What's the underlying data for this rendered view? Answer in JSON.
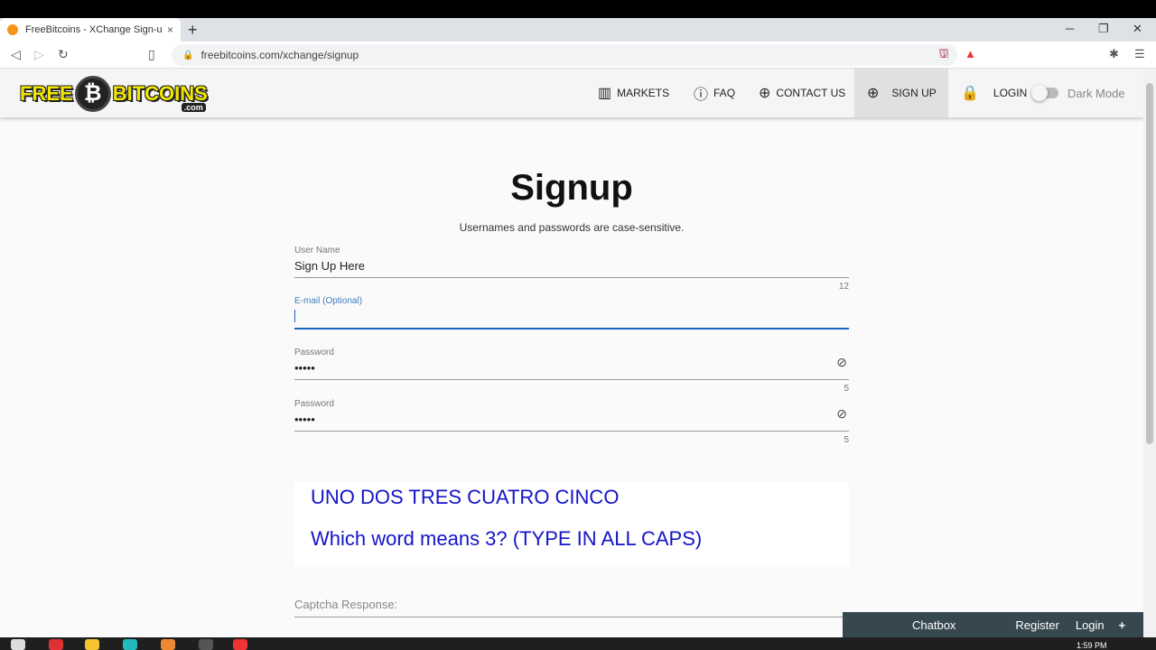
{
  "browser": {
    "tab_title": "FreeBitcoins - XChange Sign-up |",
    "tab_close": "×",
    "new_tab": "+",
    "url": "freebitcoins.com/xchange/signup",
    "win_minimize": "─",
    "win_restore": "❐",
    "win_close": "✕"
  },
  "header": {
    "logo_left": "FREE",
    "logo_coin": "₿",
    "logo_right": "BITCOINS",
    "logo_com": ".com",
    "nav": {
      "markets": "MARKETS",
      "faq": "FAQ",
      "contact": "CONTACT US",
      "signup": "SIGN UP",
      "login": "LOGIN"
    },
    "dark_mode_label": "Dark Mode"
  },
  "main": {
    "title": "Signup",
    "subtitle": "Usernames and passwords are case-sensitive.",
    "username": {
      "label": "User Name",
      "value": "Sign Up Here",
      "count": "12"
    },
    "email": {
      "label": "E-mail (Optional)",
      "value": ""
    },
    "password1": {
      "label": "Password",
      "value": "•••••",
      "count": "5"
    },
    "password2": {
      "label": "Password",
      "value": "•••••",
      "count": "5"
    },
    "captcha": {
      "line1": "UNO DOS TRES CUATRO CINCO",
      "line2": "Which word means 3? (TYPE IN ALL CAPS)"
    },
    "captcha_response_label": "Captcha Response:"
  },
  "chatbox": {
    "title": "Chatbox",
    "register": "Register",
    "login": "Login",
    "plus": "+"
  },
  "taskbar": {
    "time": "1:59 PM"
  }
}
